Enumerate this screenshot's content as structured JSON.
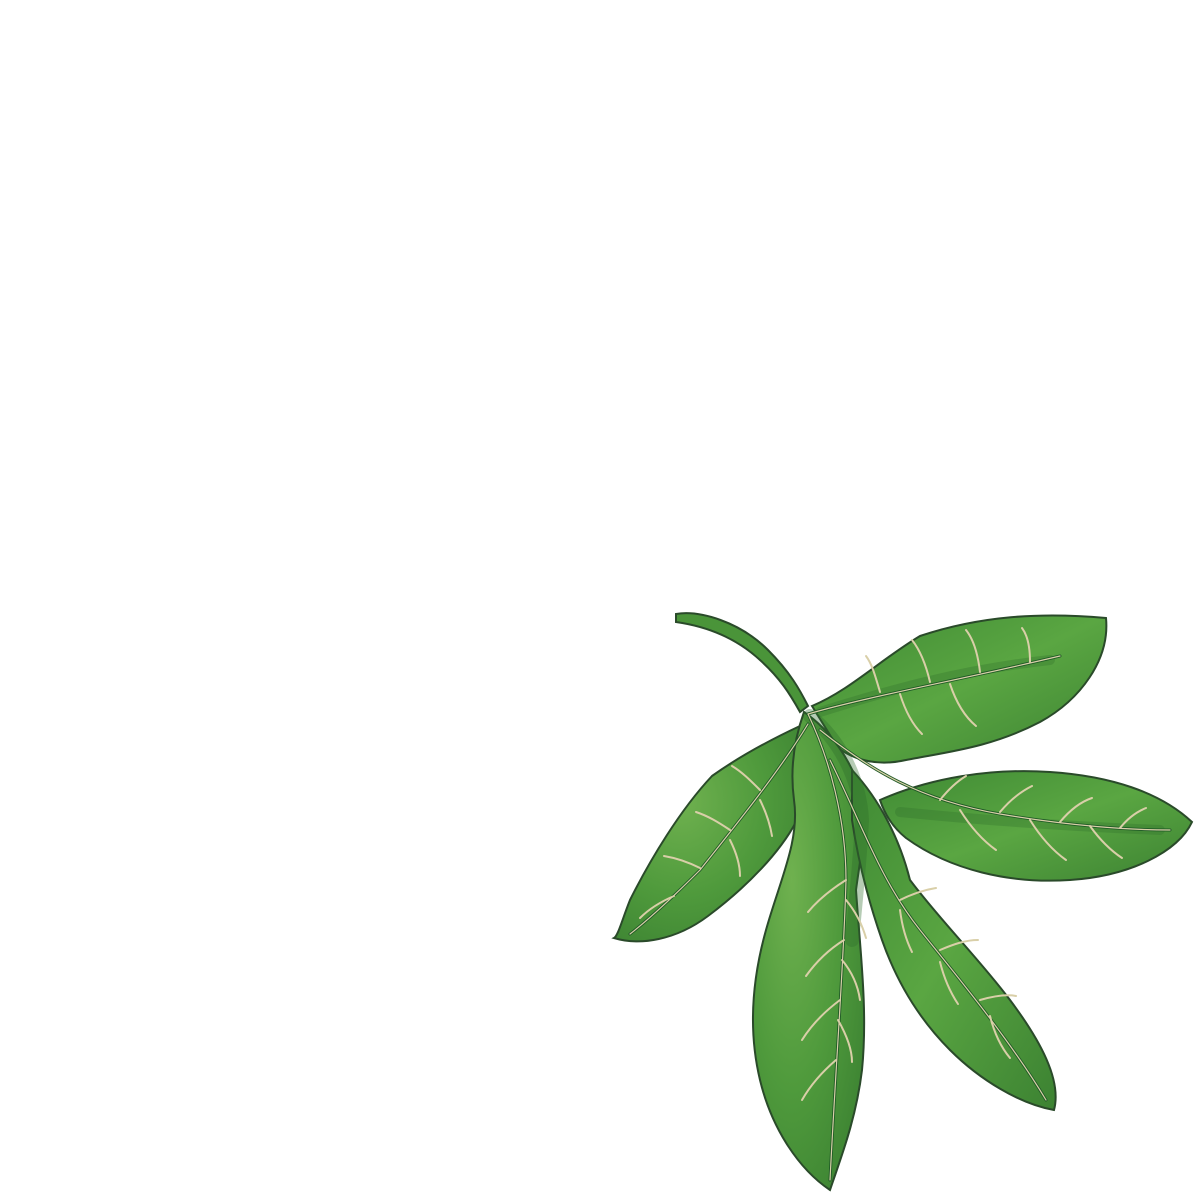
{
  "illustration": {
    "subject": "sassafras-leaf-icon",
    "style": "watercolor",
    "colors": {
      "background": "#ffffff",
      "leaf_fill": "#4f9a3c",
      "leaf_light": "#6fb14f",
      "leaf_dark": "#2f6e2a",
      "outline": "#2a4a2a",
      "veins": "#d9cfa8",
      "midrib": "#1f5a26"
    }
  }
}
